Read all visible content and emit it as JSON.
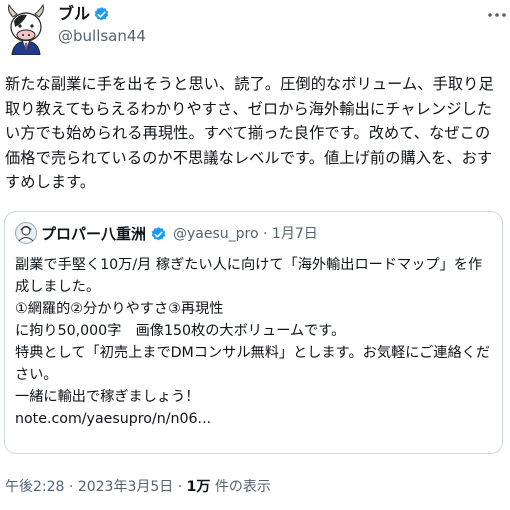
{
  "author": {
    "name": "ブル",
    "handle": "@bullsan44"
  },
  "tweet": {
    "text": "新たな副業に手を出そうと思い、読了。圧倒的なボリューム、手取り足取り教えてもらえるわかりやすさ、ゼロから海外輸出にチャレンジしたい方でも始められる再現性。すべて揃った良作です。改めて、なぜこの価格で売られているのか不思議なレベルです。値上げ前の購入を、おすすめします。"
  },
  "quote": {
    "name": "プロパー八重洲",
    "handle": "@yaesu_pro",
    "separator": " · ",
    "date": "1月7日",
    "text": "副業で手堅く10万/月 稼ぎたい人に向けて「海外輸出ロードマップ」を作成しました。\n①網羅的②分かりやすさ③再現性\nに拘り50,000字　画像150枚の大ボリュームです。\n特典として「初売上までDMコンサル無料」とします。お気軽にご連絡ください。\n一緒に輸出で稼ぎましょう！\nnote.com/yaesupro/n/n06..."
  },
  "footer": {
    "time": "午後2:28",
    "separator": " · ",
    "date": "2023年3月5日",
    "views_count": "1万",
    "views_label": " 件の表示"
  },
  "colors": {
    "verified": "#1d9bf0",
    "muted_text": "#536471",
    "border": "#cfd9de"
  },
  "icons": {
    "verified": "verified-badge-icon",
    "more": "more-options-icon"
  }
}
